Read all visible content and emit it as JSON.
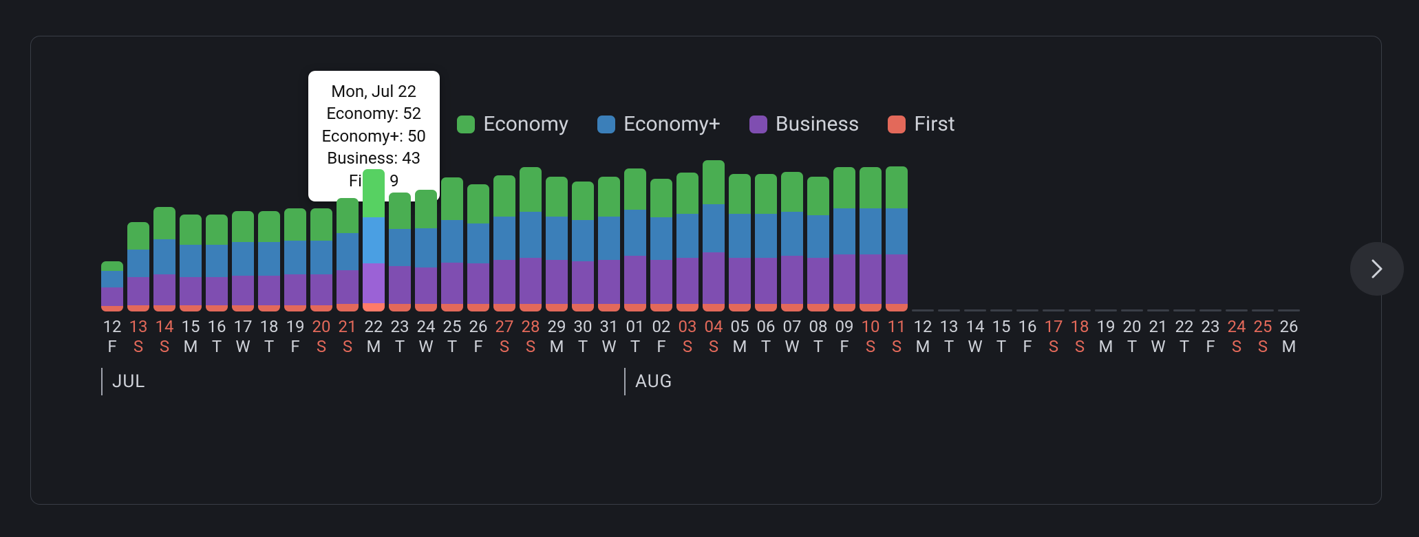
{
  "legend": {
    "economy": "Economy",
    "economy_plus": "Economy+",
    "business": "Business",
    "first": "First"
  },
  "tooltip": {
    "date": "Mon, Jul 22",
    "economy_label": "Economy",
    "economy_value": "52",
    "economy_plus_label": "Economy+",
    "economy_plus_value": "50",
    "business_label": "Business",
    "business_value": "43",
    "first_label": "First",
    "first_value": "9"
  },
  "months": {
    "jul": "JUL",
    "aug": "AUG"
  },
  "chart_data": {
    "type": "bar",
    "stacked": true,
    "series_order": [
      "first",
      "business",
      "economy_plus",
      "economy"
    ],
    "series_names": {
      "economy": "Economy",
      "economy_plus": "Economy+",
      "business": "Business",
      "first": "First"
    },
    "colors": {
      "economy": "#4aae52",
      "economy_plus": "#3b7fb9",
      "business": "#7f4eb1",
      "first": "#e3695a"
    },
    "ylim": [
      0,
      160
    ],
    "highlight_index": 10,
    "days": [
      {
        "month": "JUL",
        "day": "12",
        "dow": "F",
        "weekend": false,
        "values": {
          "first": 6,
          "business": 20,
          "economy_plus": 18,
          "economy": 10
        }
      },
      {
        "month": "JUL",
        "day": "13",
        "dow": "S",
        "weekend": true,
        "values": {
          "first": 7,
          "business": 30,
          "economy_plus": 30,
          "economy": 30
        }
      },
      {
        "month": "JUL",
        "day": "14",
        "dow": "S",
        "weekend": true,
        "values": {
          "first": 7,
          "business": 33,
          "economy_plus": 38,
          "economy": 35
        }
      },
      {
        "month": "JUL",
        "day": "15",
        "dow": "M",
        "weekend": false,
        "values": {
          "first": 7,
          "business": 30,
          "economy_plus": 35,
          "economy": 33
        }
      },
      {
        "month": "JUL",
        "day": "16",
        "dow": "T",
        "weekend": false,
        "values": {
          "first": 7,
          "business": 30,
          "economy_plus": 35,
          "economy": 33
        }
      },
      {
        "month": "JUL",
        "day": "17",
        "dow": "W",
        "weekend": false,
        "values": {
          "first": 7,
          "business": 32,
          "economy_plus": 36,
          "economy": 34
        }
      },
      {
        "month": "JUL",
        "day": "18",
        "dow": "T",
        "weekend": false,
        "values": {
          "first": 7,
          "business": 32,
          "economy_plus": 36,
          "economy": 34
        }
      },
      {
        "month": "JUL",
        "day": "19",
        "dow": "F",
        "weekend": false,
        "values": {
          "first": 7,
          "business": 33,
          "economy_plus": 37,
          "economy": 35
        }
      },
      {
        "month": "JUL",
        "day": "20",
        "dow": "S",
        "weekend": true,
        "values": {
          "first": 7,
          "business": 33,
          "economy_plus": 37,
          "economy": 35
        }
      },
      {
        "month": "JUL",
        "day": "21",
        "dow": "S",
        "weekend": true,
        "values": {
          "first": 8,
          "business": 37,
          "economy_plus": 40,
          "economy": 38
        }
      },
      {
        "month": "JUL",
        "day": "22",
        "dow": "M",
        "weekend": false,
        "values": {
          "first": 9,
          "business": 43,
          "economy_plus": 50,
          "economy": 52
        }
      },
      {
        "month": "JUL",
        "day": "23",
        "dow": "T",
        "weekend": false,
        "values": {
          "first": 8,
          "business": 41,
          "economy_plus": 40,
          "economy": 40
        }
      },
      {
        "month": "JUL",
        "day": "24",
        "dow": "W",
        "weekend": false,
        "values": {
          "first": 8,
          "business": 40,
          "economy_plus": 42,
          "economy": 42
        }
      },
      {
        "month": "JUL",
        "day": "25",
        "dow": "T",
        "weekend": false,
        "values": {
          "first": 8,
          "business": 45,
          "economy_plus": 46,
          "economy": 46
        }
      },
      {
        "month": "JUL",
        "day": "26",
        "dow": "F",
        "weekend": false,
        "values": {
          "first": 8,
          "business": 44,
          "economy_plus": 43,
          "economy": 43
        }
      },
      {
        "month": "JUL",
        "day": "27",
        "dow": "S",
        "weekend": true,
        "values": {
          "first": 8,
          "business": 48,
          "economy_plus": 47,
          "economy": 44
        }
      },
      {
        "month": "JUL",
        "day": "28",
        "dow": "S",
        "weekend": true,
        "values": {
          "first": 8,
          "business": 50,
          "economy_plus": 50,
          "economy": 48
        }
      },
      {
        "month": "JUL",
        "day": "29",
        "dow": "M",
        "weekend": false,
        "values": {
          "first": 8,
          "business": 48,
          "economy_plus": 47,
          "economy": 43
        }
      },
      {
        "month": "JUL",
        "day": "30",
        "dow": "T",
        "weekend": false,
        "values": {
          "first": 8,
          "business": 46,
          "economy_plus": 45,
          "economy": 42
        }
      },
      {
        "month": "JUL",
        "day": "31",
        "dow": "W",
        "weekend": false,
        "values": {
          "first": 8,
          "business": 48,
          "economy_plus": 47,
          "economy": 43
        }
      },
      {
        "month": "AUG",
        "day": "01",
        "dow": "T",
        "weekend": false,
        "values": {
          "first": 8,
          "business": 52,
          "economy_plus": 50,
          "economy": 45
        }
      },
      {
        "month": "AUG",
        "day": "02",
        "dow": "F",
        "weekend": false,
        "values": {
          "first": 8,
          "business": 48,
          "economy_plus": 46,
          "economy": 42
        }
      },
      {
        "month": "AUG",
        "day": "03",
        "dow": "S",
        "weekend": true,
        "values": {
          "first": 8,
          "business": 50,
          "economy_plus": 48,
          "economy": 44
        }
      },
      {
        "month": "AUG",
        "day": "04",
        "dow": "S",
        "weekend": true,
        "values": {
          "first": 8,
          "business": 56,
          "economy_plus": 52,
          "economy": 48
        }
      },
      {
        "month": "AUG",
        "day": "05",
        "dow": "M",
        "weekend": false,
        "values": {
          "first": 8,
          "business": 50,
          "economy_plus": 48,
          "economy": 43
        }
      },
      {
        "month": "AUG",
        "day": "06",
        "dow": "T",
        "weekend": false,
        "values": {
          "first": 8,
          "business": 50,
          "economy_plus": 48,
          "economy": 43
        }
      },
      {
        "month": "AUG",
        "day": "07",
        "dow": "W",
        "weekend": false,
        "values": {
          "first": 8,
          "business": 52,
          "economy_plus": 48,
          "economy": 43
        }
      },
      {
        "month": "AUG",
        "day": "08",
        "dow": "T",
        "weekend": false,
        "values": {
          "first": 8,
          "business": 50,
          "economy_plus": 46,
          "economy": 42
        }
      },
      {
        "month": "AUG",
        "day": "09",
        "dow": "F",
        "weekend": false,
        "values": {
          "first": 8,
          "business": 54,
          "economy_plus": 50,
          "economy": 44
        }
      },
      {
        "month": "AUG",
        "day": "10",
        "dow": "S",
        "weekend": true,
        "values": {
          "first": 8,
          "business": 54,
          "economy_plus": 50,
          "economy": 44
        }
      },
      {
        "month": "AUG",
        "day": "11",
        "dow": "S",
        "weekend": true,
        "values": {
          "first": 8,
          "business": 54,
          "economy_plus": 50,
          "economy": 45
        }
      },
      {
        "month": "AUG",
        "day": "12",
        "dow": "M",
        "weekend": false,
        "values": null
      },
      {
        "month": "AUG",
        "day": "13",
        "dow": "T",
        "weekend": false,
        "values": null
      },
      {
        "month": "AUG",
        "day": "14",
        "dow": "W",
        "weekend": false,
        "values": null
      },
      {
        "month": "AUG",
        "day": "15",
        "dow": "T",
        "weekend": false,
        "values": null
      },
      {
        "month": "AUG",
        "day": "16",
        "dow": "F",
        "weekend": false,
        "values": null
      },
      {
        "month": "AUG",
        "day": "17",
        "dow": "S",
        "weekend": true,
        "values": null
      },
      {
        "month": "AUG",
        "day": "18",
        "dow": "S",
        "weekend": true,
        "values": null
      },
      {
        "month": "AUG",
        "day": "19",
        "dow": "M",
        "weekend": false,
        "values": null
      },
      {
        "month": "AUG",
        "day": "20",
        "dow": "T",
        "weekend": false,
        "values": null
      },
      {
        "month": "AUG",
        "day": "21",
        "dow": "W",
        "weekend": false,
        "values": null
      },
      {
        "month": "AUG",
        "day": "22",
        "dow": "T",
        "weekend": false,
        "values": null
      },
      {
        "month": "AUG",
        "day": "23",
        "dow": "F",
        "weekend": false,
        "values": null
      },
      {
        "month": "AUG",
        "day": "24",
        "dow": "S",
        "weekend": true,
        "values": null
      },
      {
        "month": "AUG",
        "day": "25",
        "dow": "S",
        "weekend": true,
        "values": null
      },
      {
        "month": "AUG",
        "day": "26",
        "dow": "M",
        "weekend": false,
        "values": null
      }
    ]
  }
}
